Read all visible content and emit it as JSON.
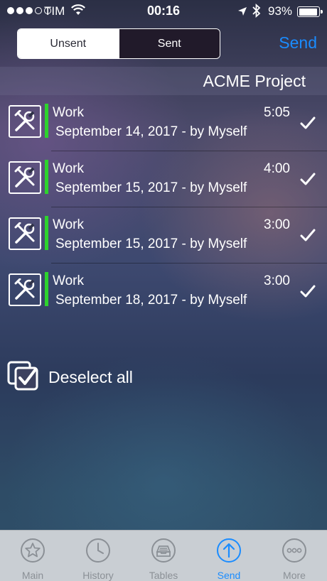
{
  "status_bar": {
    "carrier": "TIM",
    "signal_bars_filled": 3,
    "signal_bars_total": 5,
    "time": "00:16",
    "battery": "93%"
  },
  "segmented": {
    "tabs": [
      {
        "label": "Unsent",
        "selected": true
      },
      {
        "label": "Sent",
        "selected": false
      }
    ]
  },
  "header": {
    "send_label": "Send"
  },
  "project": {
    "name": "ACME Project"
  },
  "entries": [
    {
      "title": "Work",
      "duration": "5:05",
      "subtitle": "September 14, 2017 - by Myself",
      "icon": "tools-icon",
      "checked": true
    },
    {
      "title": "Work",
      "duration": "4:00",
      "subtitle": "September 15, 2017 - by Myself",
      "icon": "tools-icon",
      "checked": true
    },
    {
      "title": "Work",
      "duration": "3:00",
      "subtitle": "September 15, 2017 - by Myself",
      "icon": "tools-icon",
      "checked": true
    },
    {
      "title": "Work",
      "duration": "3:00",
      "subtitle": "September 18, 2017 - by Myself",
      "icon": "tools-icon",
      "checked": true
    }
  ],
  "deselect": {
    "label": "Deselect all"
  },
  "tab_bar": {
    "items": [
      {
        "label": "Main",
        "icon": "star-icon"
      },
      {
        "label": "History",
        "icon": "clock-icon"
      },
      {
        "label": "Tables",
        "icon": "tray-icon"
      },
      {
        "label": "Send",
        "icon": "upload-icon",
        "active": true
      },
      {
        "label": "More",
        "icon": "more-icon"
      }
    ]
  },
  "colors": {
    "accent": "#1a8cff",
    "entry_bar": "#2dd42d"
  }
}
